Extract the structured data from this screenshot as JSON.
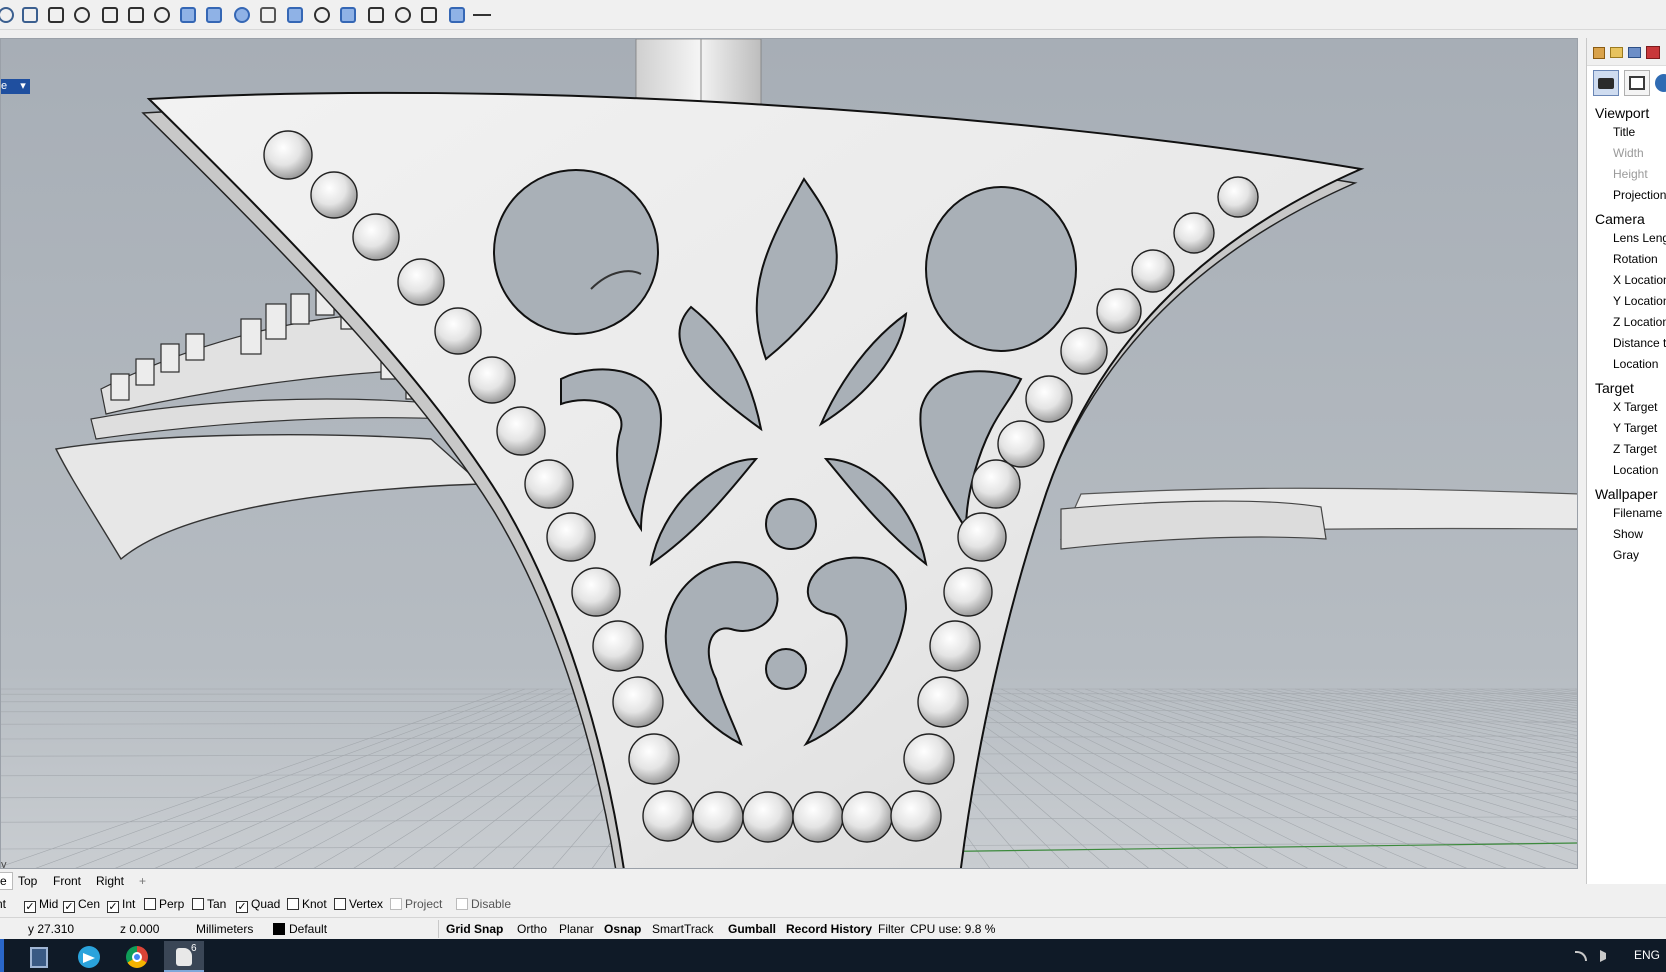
{
  "toolbar": {
    "icons": [
      "lasso-select-icon",
      "select-curve-icon",
      "fillet-curves-icon",
      "arc-curve-icon",
      "curve-offset-icon",
      "gumball-move-icon",
      "gumball-rotate-icon",
      "box-solid-icon",
      "box-edit-icon",
      "sphere-solid-icon",
      "mirror-icon",
      "rotate-3d-icon",
      "control-points-icon",
      "surface-project-icon",
      "line-icon",
      "polyline-icon",
      "rectangle-crop-icon",
      "boolean-union-icon",
      "more-toolbar-icon"
    ]
  },
  "viewport": {
    "menu_label": "e",
    "menu_arrow": "▾",
    "axis_label": "y"
  },
  "right_panel": {
    "sections": [
      {
        "title": "Viewport",
        "rows": [
          {
            "label": "Title",
            "dim": false
          },
          {
            "label": "Width",
            "dim": true
          },
          {
            "label": "Height",
            "dim": true
          },
          {
            "label": "Projection",
            "dim": false
          }
        ]
      },
      {
        "title": "Camera",
        "rows": [
          {
            "label": "Lens Leng",
            "dim": false
          },
          {
            "label": "Rotation",
            "dim": false
          },
          {
            "label": "X Location",
            "dim": false
          },
          {
            "label": "Y Location",
            "dim": false
          },
          {
            "label": "Z Location",
            "dim": false
          },
          {
            "label": "Distance t",
            "dim": false
          },
          {
            "label": "Location",
            "dim": false
          }
        ]
      },
      {
        "title": "Target",
        "rows": [
          {
            "label": "X Target",
            "dim": false
          },
          {
            "label": "Y Target",
            "dim": false
          },
          {
            "label": "Z Target",
            "dim": false
          },
          {
            "label": "Location",
            "dim": false
          }
        ]
      },
      {
        "title": "Wallpaper",
        "rows": [
          {
            "label": "Filename",
            "dim": false
          },
          {
            "label": "Show",
            "dim": false
          },
          {
            "label": "Gray",
            "dim": false
          }
        ]
      }
    ]
  },
  "viewport_tabs": {
    "partial": "e",
    "tabs": [
      "Top",
      "Front",
      "Right"
    ],
    "add": "+"
  },
  "osnaps": [
    {
      "label": "nt",
      "checked": null,
      "disabled": false
    },
    {
      "label": "Mid",
      "checked": true,
      "disabled": false
    },
    {
      "label": "Cen",
      "checked": true,
      "disabled": false
    },
    {
      "label": "Int",
      "checked": true,
      "disabled": false
    },
    {
      "label": "Perp",
      "checked": false,
      "disabled": false
    },
    {
      "label": "Tan",
      "checked": false,
      "disabled": false
    },
    {
      "label": "Quad",
      "checked": true,
      "disabled": false
    },
    {
      "label": "Knot",
      "checked": false,
      "disabled": false
    },
    {
      "label": "Vertex",
      "checked": false,
      "disabled": false
    },
    {
      "label": "Project",
      "checked": false,
      "disabled": true
    },
    {
      "label": "Disable",
      "checked": false,
      "disabled": true
    }
  ],
  "statusbar": {
    "y": "y 27.310",
    "z": "z 0.000",
    "units": "Millimeters",
    "layer": "Default",
    "layer_color": "#000000",
    "toggles": [
      {
        "label": "Grid Snap",
        "bold": true
      },
      {
        "label": "Ortho",
        "bold": false
      },
      {
        "label": "Planar",
        "bold": false
      },
      {
        "label": "Osnap",
        "bold": true
      },
      {
        "label": "SmartTrack",
        "bold": false
      },
      {
        "label": "Gumball",
        "bold": true
      },
      {
        "label": "Record History",
        "bold": true
      },
      {
        "label": "Filter",
        "bold": false
      }
    ],
    "cpu": "CPU use: 9.8 %"
  },
  "taskbar": {
    "apps": [
      "calculator-icon",
      "telegram-icon",
      "chrome-icon",
      "rhino-icon"
    ],
    "rhino_badge": "6",
    "language": "ENG"
  },
  "colors": {
    "viewport_bg": "#a9b0b7",
    "model": "#ececec",
    "accent": "#1f4f9f"
  }
}
